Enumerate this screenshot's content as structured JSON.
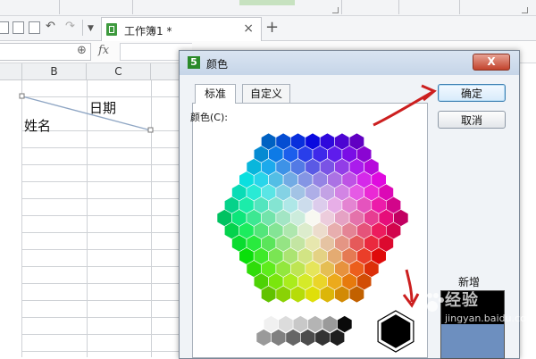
{
  "document_tab": {
    "title": "工作簿1 *",
    "close_symbol": "×",
    "new_tab_symbol": "+"
  },
  "formula_bar": {
    "fx_symbol": "fx",
    "dropdown_symbol": "▼"
  },
  "sheet": {
    "columns": [
      "B",
      "C"
    ],
    "header_cell": {
      "upper_text": "日期",
      "lower_text": "姓名"
    }
  },
  "dialog": {
    "title": "颜色",
    "app_badge": "5",
    "close_symbol": "X",
    "tabs": [
      {
        "label": "标准"
      },
      {
        "label": "自定义"
      }
    ],
    "colors_label": "颜色(C):",
    "ok_button": "确定",
    "cancel_button": "取消",
    "new_label": "新增",
    "new_color": "#000000",
    "current_color": "#6d8fbf"
  },
  "annotation_color": "#cc1f1f",
  "watermark": {
    "text": "经验",
    "url": "jingyan.baidu.com"
  }
}
